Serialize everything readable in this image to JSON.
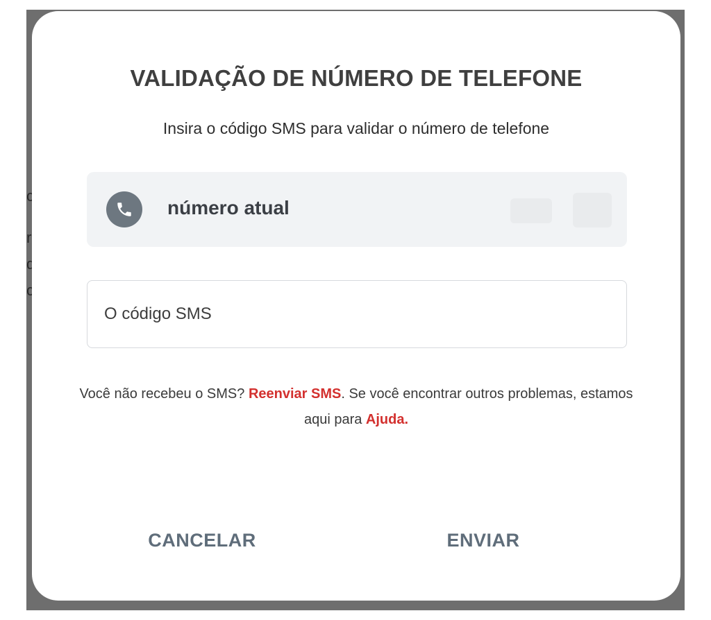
{
  "background_fragments": [
    "c",
    "r",
    "d",
    "c"
  ],
  "modal": {
    "title": "VALIDAÇÃO DE NÚMERO DE TELEFONE",
    "subtitle": "Insira o código SMS para validar o número de telefone",
    "current_number": {
      "icon": "phone-icon",
      "label": "número atual"
    },
    "sms_input": {
      "value": "",
      "placeholder": "O código SMS"
    },
    "help": {
      "part1": "Você não recebeu o SMS? ",
      "resend_link": "Reenviar SMS",
      "part2": ". Se você encontrar outros problemas, estamos aqui para ",
      "help_link": "Ajuda."
    },
    "buttons": {
      "cancel": "CANCELAR",
      "send": "ENVIAR"
    }
  },
  "colors": {
    "link": "#d3302e",
    "button_text": "#5f6d7a",
    "icon_circle": "#6d7780",
    "number_bg": "#f1f3f5"
  }
}
